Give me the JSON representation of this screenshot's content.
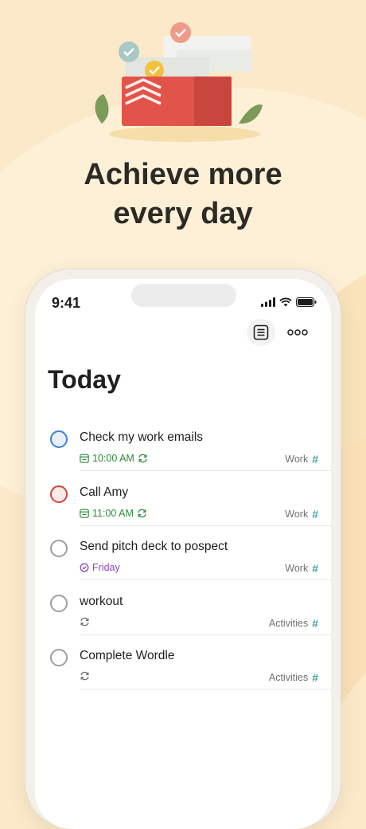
{
  "headline": {
    "line1": "Achieve more",
    "line2": "every day"
  },
  "status_bar": {
    "time": "9:41"
  },
  "toolbar": {
    "view_icon": "list-view-icon",
    "more_icon": "more-options-icon"
  },
  "page": {
    "title": "Today"
  },
  "tasks": [
    {
      "name": "Check my work emails",
      "due": "10:00 AM",
      "recurring": true,
      "project": "Work",
      "priority_color": "#3f7fd6",
      "priority_fill": "#e8f0fb"
    },
    {
      "name": "Call Amy",
      "due": "11:00 AM",
      "recurring": true,
      "project": "Work",
      "priority_color": "#d1453b",
      "priority_fill": "#fbeaea"
    },
    {
      "name": "Send pitch deck to pospect",
      "due": "Friday",
      "recurring": false,
      "project": "Work",
      "priority_color": "#9e9e9e",
      "priority_fill": "#ffffff"
    },
    {
      "name": "workout",
      "due": "",
      "recurring": true,
      "project": "Activities",
      "priority_color": "#9e9e9e",
      "priority_fill": "#ffffff"
    },
    {
      "name": "Complete Wordle",
      "due": "",
      "recurring": true,
      "project": "Activities",
      "priority_color": "#9e9e9e",
      "priority_fill": "#ffffff"
    }
  ],
  "colors": {
    "accent_red": "#e2544a",
    "date_green": "#2e8b3d",
    "upcoming_purple": "#8a47c4",
    "project_teal": "#3fa1a5"
  }
}
